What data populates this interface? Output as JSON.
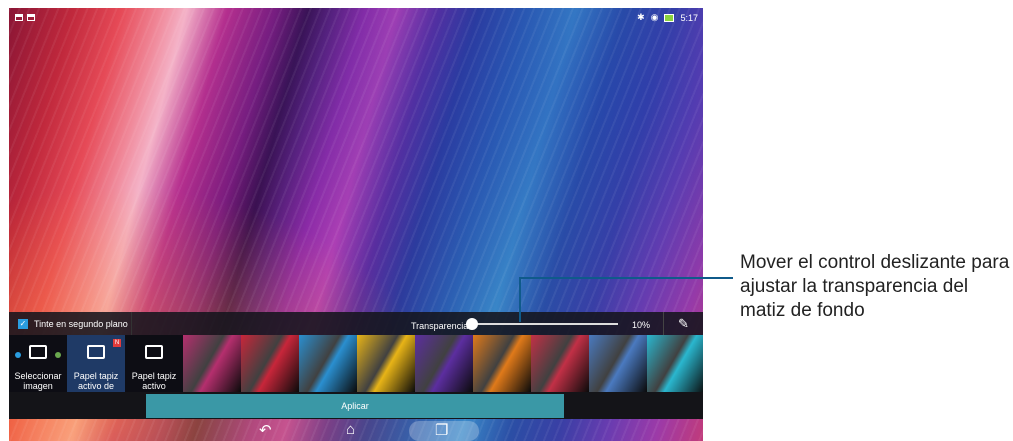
{
  "status_bar": {
    "time": "5:17",
    "bluetooth_icon": "bluetooth-icon",
    "wifi_icon": "wifi-icon",
    "battery_icon": "battery-icon"
  },
  "panel": {
    "tint_label": "Tinte en segundo plano",
    "tint_checked": true,
    "transparency_label": "Transparencia",
    "transparency_value": "10%",
    "transparency_level": 0.0,
    "edit_icon": "pencil-icon"
  },
  "thumbnails": {
    "select_image": "Seleccionar imagen",
    "live_wallpaper_1": "Papel tapiz activo de",
    "live_wallpaper_2": "Papel tapiz activo",
    "badge": "N",
    "colors": [
      "#b52f6e",
      "#c8263a",
      "#2a8fd0",
      "#e8b417",
      "#5c2ea0",
      "#e07a1a",
      "#c23046",
      "#4a7ac0",
      "#2ab7cf"
    ]
  },
  "apply_button": "Aplicar",
  "navigation": {
    "back_icon": "back-icon",
    "home_icon": "home-icon",
    "recent_icon": "recent-apps-icon"
  },
  "callout": {
    "text": "Mover el control deslizante para ajustar la transparencia del matiz de fondo"
  }
}
